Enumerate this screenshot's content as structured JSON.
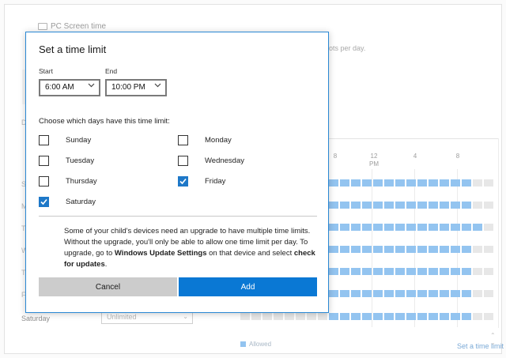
{
  "background": {
    "header_title": "PC Screen time",
    "partial_subtext": "ots per day.",
    "partial_letter": "D",
    "day_labels": [
      "S",
      "M",
      "T",
      "W",
      "T",
      "F",
      "Saturday"
    ],
    "saturday_select_value": "Unlimited",
    "chart_ticks": [
      "8",
      "12\nPM",
      "4",
      "8"
    ],
    "legend_label": "Allowed",
    "set_time_limit_link": "Set a time limit",
    "colors": {
      "allowed": "#93c4f0",
      "not_allowed": "#e7e7e7",
      "accent": "#0a78d4"
    }
  },
  "dialog": {
    "title": "Set a time limit",
    "start": {
      "label": "Start",
      "value": "6:00 AM"
    },
    "end": {
      "label": "End",
      "value": "10:00 PM"
    },
    "days_heading": "Choose which days have this time limit:",
    "days": [
      {
        "label": "Sunday",
        "checked": false
      },
      {
        "label": "Monday",
        "checked": false
      },
      {
        "label": "Tuesday",
        "checked": false
      },
      {
        "label": "Wednesday",
        "checked": false
      },
      {
        "label": "Thursday",
        "checked": false
      },
      {
        "label": "Friday",
        "checked": true
      },
      {
        "label": "Saturday",
        "checked": true
      }
    ],
    "notice": {
      "part1": "Some of your child's devices need an upgrade to have multiple time limits. Without the upgrade, you'll only be able to allow one time limit per day. To upgrade, go to ",
      "bold1": "Windows Update Settings",
      "part2": " on that device and select ",
      "bold2": "check for updates",
      "part3": "."
    },
    "cancel_label": "Cancel",
    "add_label": "Add"
  }
}
